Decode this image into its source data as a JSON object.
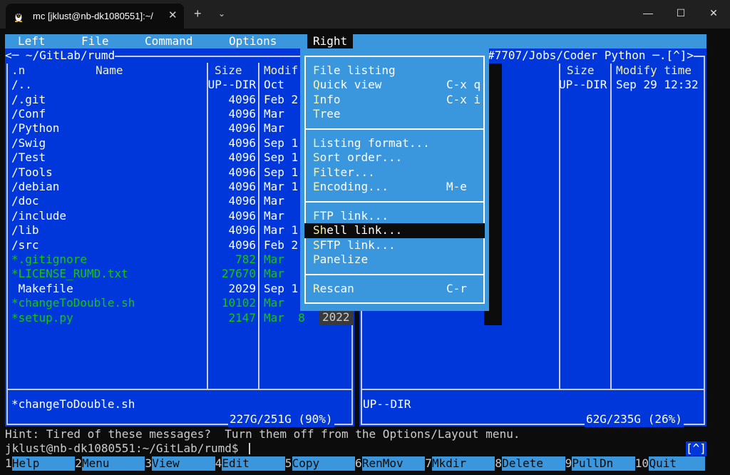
{
  "window": {
    "tab_title": "mc [jklust@nb-dk1080551]:~/",
    "new_tab": "+",
    "dropdown": "⌄",
    "close_tab": "✕",
    "minimize": "—",
    "maximize": "☐",
    "close": "✕"
  },
  "menubar": {
    "left": "Left",
    "file": "File",
    "command": "Command",
    "options": "Options",
    "right": "Right"
  },
  "left_panel": {
    "path": "<─ ~/GitLab/rumd",
    "col_name_prefix": ".n",
    "col_name": "Name",
    "col_size": "Size",
    "col_modify": "Modif",
    "rows": [
      {
        "name": "/..",
        "size": "UP--DIR",
        "mod": "Oct",
        "kind": "dir"
      },
      {
        "name": "/.git",
        "size": "4096",
        "mod": "Feb 2",
        "kind": "dir"
      },
      {
        "name": "/Conf",
        "size": "4096",
        "mod": "Mar",
        "kind": "dir"
      },
      {
        "name": "/Python",
        "size": "4096",
        "mod": "Mar",
        "kind": "dir"
      },
      {
        "name": "/Swig",
        "size": "4096",
        "mod": "Sep 1",
        "kind": "dir"
      },
      {
        "name": "/Test",
        "size": "4096",
        "mod": "Sep 1",
        "kind": "dir"
      },
      {
        "name": "/Tools",
        "size": "4096",
        "mod": "Sep 1",
        "kind": "dir"
      },
      {
        "name": "/debian",
        "size": "4096",
        "mod": "Mar 1",
        "kind": "dir"
      },
      {
        "name": "/doc",
        "size": "4096",
        "mod": "Mar",
        "kind": "dir"
      },
      {
        "name": "/include",
        "size": "4096",
        "mod": "Mar",
        "kind": "dir"
      },
      {
        "name": "/lib",
        "size": "4096",
        "mod": "Mar 1",
        "kind": "dir"
      },
      {
        "name": "/src",
        "size": "4096",
        "mod": "Feb 2",
        "kind": "dir"
      },
      {
        "name": "*.gitignore",
        "size": "782",
        "mod": "Mar",
        "kind": "exec"
      },
      {
        "name": "*LICENSE_RUMD.txt",
        "size": "27670",
        "mod": "Mar",
        "kind": "exec"
      },
      {
        "name": " Makefile",
        "size": "2029",
        "mod": "Sep 1",
        "kind": "file"
      },
      {
        "name": "*changeToDouble.sh",
        "size": "10102",
        "mod": "Mar",
        "kind": "exec"
      },
      {
        "name": "*setup.py",
        "size": "2147",
        "mod": "Mar  8",
        "kind": "exec"
      }
    ],
    "selected_year": "2022",
    "status": "*changeToDouble.sh",
    "disk": "227G/251G (90%)"
  },
  "right_panel": {
    "path": "#7707/Jobs/Coder Python ─.[^]>",
    "col_size": "Size",
    "col_modify": "Modify time",
    "rows": [
      {
        "size": "UP--DIR",
        "mod": "Sep 29 12:32"
      }
    ],
    "status": "UP--DIR",
    "disk": "62G/235G (26%)"
  },
  "right_menu": {
    "items": [
      {
        "hot": "F",
        "rest": "ile listing",
        "shortcut": ""
      },
      {
        "hot": "Q",
        "rest": "uick view",
        "shortcut": "C-x q"
      },
      {
        "hot": "I",
        "rest": "nfo",
        "shortcut": "C-x i"
      },
      {
        "hot": "T",
        "rest": "ree",
        "shortcut": ""
      },
      {
        "hot": "L",
        "rest": "isting format...",
        "shortcut": ""
      },
      {
        "hot": "S",
        "rest": "ort order...",
        "shortcut": ""
      },
      {
        "hot": "F",
        "rest": "ilter...",
        "shortcut": ""
      },
      {
        "hot": "E",
        "rest": "ncoding...",
        "shortcut": "M-e"
      },
      {
        "hot": "F",
        "rest": "TP link...",
        "shortcut": ""
      },
      {
        "hot": "Sh",
        "rest": "ell link...",
        "shortcut": ""
      },
      {
        "hot": "S",
        "rest": "FTP link...",
        "shortcut": ""
      },
      {
        "hot": "P",
        "rest": "anelize",
        "shortcut": ""
      },
      {
        "hot": "R",
        "rest": "escan",
        "shortcut": "C-r"
      }
    ]
  },
  "hint": "Hint: Tired of these messages?  Turn them off from the Options/Layout menu.",
  "prompt": "jklust@nb-dk1080551:~/GitLab/rumd$ ",
  "prompt_marker": "[^]",
  "fkeys": [
    {
      "num": "1",
      "label": "Help"
    },
    {
      "num": "2",
      "label": "Menu"
    },
    {
      "num": "3",
      "label": "View"
    },
    {
      "num": "4",
      "label": "Edit"
    },
    {
      "num": "5",
      "label": "Copy"
    },
    {
      "num": "6",
      "label": "RenMov"
    },
    {
      "num": "7",
      "label": "Mkdir"
    },
    {
      "num": "8",
      "label": "Delete"
    },
    {
      "num": "9",
      "label": "PullDn"
    },
    {
      "num": "10",
      "label": "Quit"
    }
  ],
  "colors": {
    "panel_bg": "#0037da",
    "menu_bg": "#3a96dd",
    "exec_green": "#16c60c",
    "hotkey_yellow": "#f9f1a5"
  }
}
